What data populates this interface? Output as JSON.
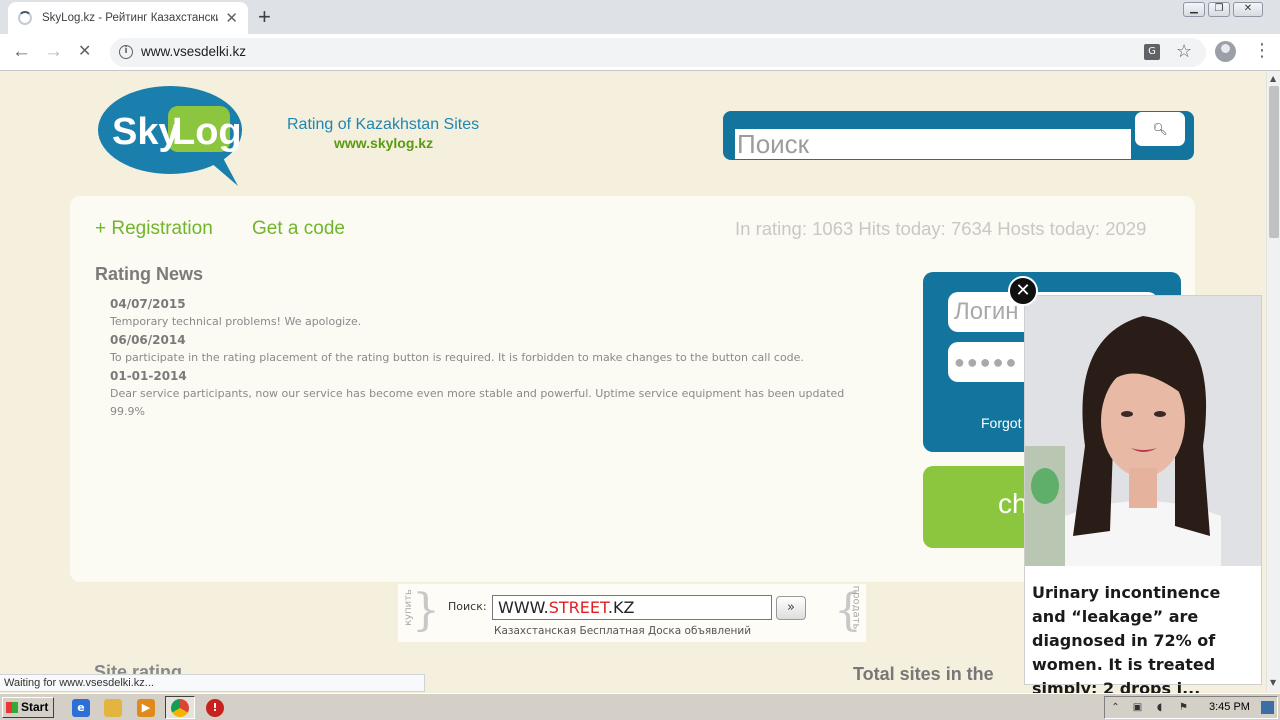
{
  "browser": {
    "tab_title": "SkyLog.kz - Рейтинг Казахстанских",
    "tab_close": "✕",
    "new_tab": "+",
    "url": "www.vsesdelki.kz",
    "back": "←",
    "forward": "→",
    "stop": "✕",
    "menu": "⋮",
    "status_text": "Waiting for www.vsesdelki.kz..."
  },
  "header": {
    "logo_text_sky": "Sky",
    "logo_text_log": "Log",
    "rating_title": "Rating of Kazakhstan Sites",
    "site_url": "www.skylog.kz",
    "search_placeholder": "Поиск"
  },
  "nav": {
    "registration": "+ Registration",
    "get_code": "Get a code",
    "stats": "In rating: 1063 Hits today: 7634 Hosts today: 2029"
  },
  "news": {
    "heading": "Rating News",
    "items": [
      {
        "date": "04/07/2015",
        "text": "Temporary technical problems! We apologize."
      },
      {
        "date": "06/06/2014",
        "text": "To participate in the rating placement of the rating button is required. It is forbidden to make changes to the button call code."
      },
      {
        "date": "01-01-2014",
        "text": "Dear service participants, now our service has become even more stable and powerful. Uptime service equipment has been updated 99.9%"
      }
    ]
  },
  "login": {
    "login_placeholder": "Логин",
    "password_mask": "●●●●●",
    "forgot": "Forgot",
    "green_label": "ch"
  },
  "street": {
    "left_word": "купить",
    "right_word": "продать",
    "label": "Поиск:",
    "value_prefix": "WWW.",
    "value_red": "STREET",
    "value_suffix": ".KZ",
    "go": "»",
    "subtitle": "Казахстанская Бесплатная Доска объявлений"
  },
  "footer": {
    "site_rating": "Site rating",
    "total_sites": "Total sites in the"
  },
  "ad": {
    "close": "✕",
    "text": "Urinary incontinence and “leakage” are diagnosed in 72% of women. It is treated simply: 2 drops i..."
  },
  "taskbar": {
    "start": "Start",
    "clock": "3:45 PM"
  },
  "colors": {
    "page_bg": "#f4f0dd",
    "brand_blue": "#13749e",
    "brand_green": "#8cc63f",
    "link_green": "#70b52b"
  }
}
